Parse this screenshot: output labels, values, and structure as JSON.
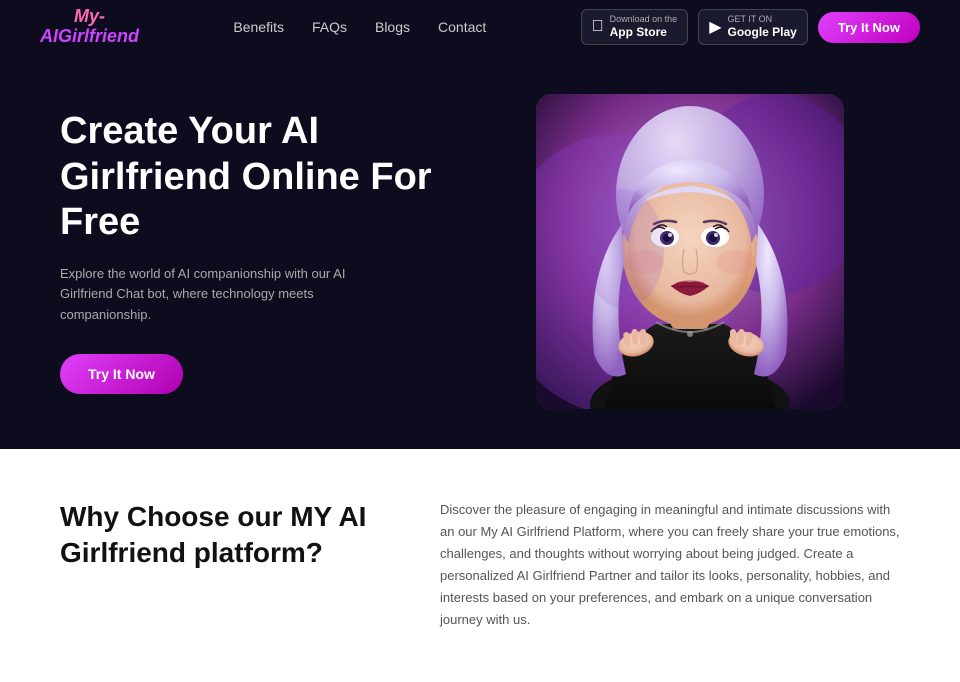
{
  "header": {
    "logo": {
      "line1": "My-",
      "line2": "AIGirlfriend"
    },
    "nav": {
      "items": [
        {
          "label": "Benefits",
          "href": "#"
        },
        {
          "label": "FAQs",
          "href": "#"
        },
        {
          "label": "Blogs",
          "href": "#"
        },
        {
          "label": "Contact",
          "href": "#"
        }
      ]
    },
    "appstore": {
      "sub": "Download on the",
      "name": "App Store",
      "icon": ""
    },
    "googleplay": {
      "sub": "GET IT ON",
      "name": "Google Play",
      "icon": "▶"
    },
    "try_now_label": "Try It Now"
  },
  "hero": {
    "title": "Create Your AI Girlfriend Online For Free",
    "subtitle": "Explore the world of AI companionship with our AI Girlfriend Chat bot, where technology meets companionship.",
    "cta_label": "Try It Now"
  },
  "why": {
    "title": "Why Choose our MY AI Girlfriend platform?",
    "description": "Discover the pleasure of engaging in meaningful and intimate discussions with an our My AI Girlfriend Platform, where you can freely share your true emotions, challenges, and thoughts without worrying about being judged. Create a personalized AI Girlfriend Partner and tailor its looks, personality, hobbies, and interests based on your preferences, and embark on a unique conversation journey with us."
  }
}
